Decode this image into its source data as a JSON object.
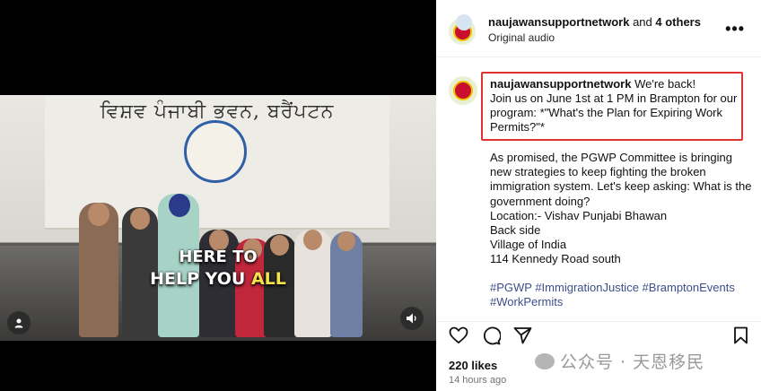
{
  "post": {
    "author": "naujawansupportnetwork",
    "collab_suffix": " and ",
    "collab_others": "4 others",
    "audio": "Original audio",
    "more_label": "•••"
  },
  "video": {
    "banner_title": "ਵਿਸ਼ਵ ਪੰਜਾਬੀ ਭਵਨ, ਬਰੈਂਪਟਨ",
    "caption_line1": "HERE TO",
    "caption_line2_a": "HELP YOU ",
    "caption_line2_b": "ALL"
  },
  "caption": {
    "username": "naujawansupportnetwork",
    "intro": " We're back!",
    "line2": "Join us on June 1st at 1 PM in Brampton for our program: *\"What's the Plan for Expiring Work Permits?\"*",
    "body": [
      "As promised, the PGWP Committee is bringing new strategies to keep fighting the broken immigration system. Let's keep asking: What is the government doing?",
      "Location:- Vishav Punjabi Bhawan",
      "Back side",
      "Village of India",
      "114 Kennedy Road south"
    ],
    "hashtags_line1": "#PGWP #ImmigrationJustice #BramptonEvents",
    "hashtags_line2": "#WorkPermits"
  },
  "stats": {
    "likes": "220 likes",
    "time": "14 hours ago"
  },
  "watermark": "公众号 · 天恩移民",
  "colors": {
    "highlight_box": "#e0322e",
    "hashtag": "#3b4f8a",
    "caption_highlight": "#f4e24b"
  }
}
